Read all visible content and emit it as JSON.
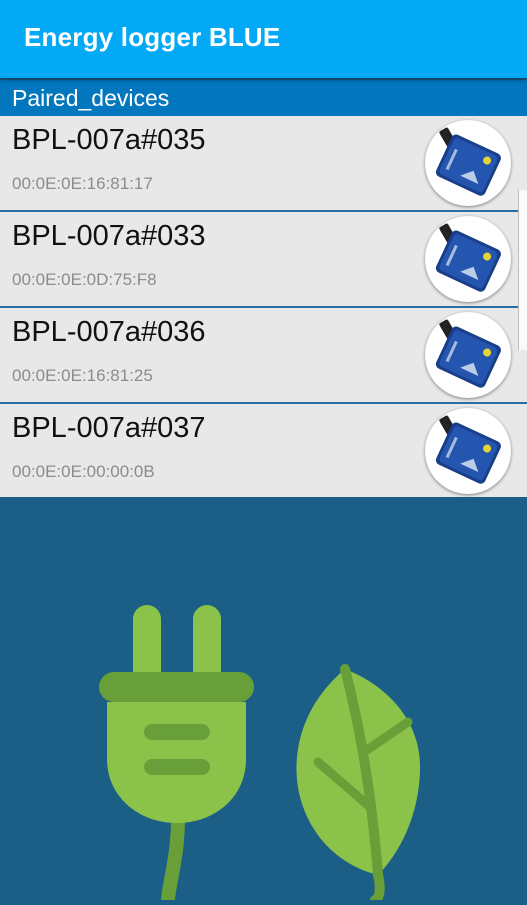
{
  "app": {
    "title": "Energy logger BLUE"
  },
  "section": {
    "header": "Paired_devices"
  },
  "devices": [
    {
      "name": "BPL-007a#035",
      "address": "00:0E:0E:16:81:17",
      "icon": "device-thumbnail-icon"
    },
    {
      "name": "BPL-007a#033",
      "address": "00:0E:0E:0D:75:F8",
      "icon": "device-thumbnail-icon"
    },
    {
      "name": "BPL-007a#036",
      "address": "00:0E:0E:16:81:25",
      "icon": "device-thumbnail-icon"
    },
    {
      "name": "BPL-007a#037",
      "address": "00:0E:0E:00:00:0B",
      "icon": "device-thumbnail-icon"
    }
  ],
  "hero": {
    "icon": "plug-leaf-icon"
  },
  "colors": {
    "appbar": "#03a9f4",
    "section_header": "#0277bd",
    "background": "#1b5e86",
    "plug_green": "#8bc34a",
    "leaf_green": "#689f38"
  }
}
